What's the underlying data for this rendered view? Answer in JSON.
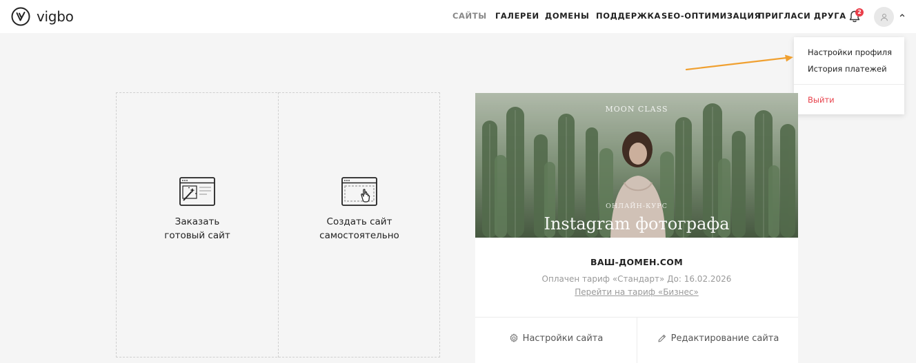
{
  "logo": {
    "text": "vigbo"
  },
  "nav": {
    "items": [
      {
        "label": "САЙТЫ",
        "active": true
      },
      {
        "label": "ГАЛЕРЕИ",
        "active": false
      },
      {
        "label": "ДОМЕНЫ",
        "active": false
      },
      {
        "label": "ПОДДЕРЖКА",
        "active": false
      },
      {
        "label": "SEO-ОПТИМИЗАЦИЯ",
        "active": false
      },
      {
        "label": "ПРИГЛАСИ ДРУГА",
        "active": false
      }
    ]
  },
  "notifications": {
    "icon": "bell-icon",
    "count": "2"
  },
  "profile_menu": {
    "items": [
      {
        "label": "Настройки профиля"
      },
      {
        "label": "История платежей"
      },
      {
        "label": "Выйти"
      }
    ]
  },
  "create": {
    "order_ready": {
      "label_line1": "Заказать",
      "label_line2": "готовый сайт"
    },
    "create_self": {
      "label_line1": "Создать сайт",
      "label_line2": "самостоятельно"
    }
  },
  "site": {
    "preview": {
      "brand": "MOON CLASS",
      "subtitle": "ОНЛАЙН-КУРС",
      "title": "Instagram фотографа"
    },
    "domain": "ВАШ-ДОМЕН.COM",
    "plan": "Оплачен тариф «Стандарт» До: 16.02.2026",
    "upgrade_link": "Перейти на тариф «Бизнес»",
    "settings_button": "Настройки сайта",
    "edit_button": "Редактирование сайта"
  },
  "colors": {
    "accent_red": "#e8404a",
    "annotation_arrow": "#f0a030",
    "background": "#f5f5f5"
  }
}
